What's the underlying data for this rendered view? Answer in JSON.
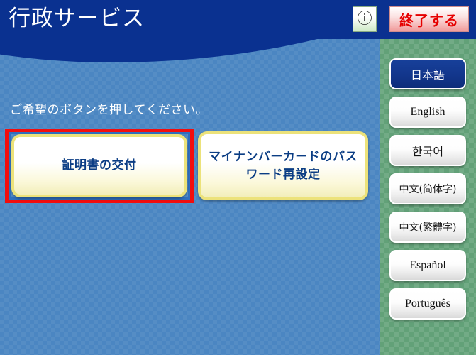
{
  "header": {
    "title": "行政サービス",
    "help_icon": "question-mark-circle-icon",
    "help_label": "?",
    "exit_label": "終了する"
  },
  "main": {
    "instruction": "ご希望のボタンを押してください。",
    "buttons": [
      {
        "label": "証明書の交付",
        "selected": true
      },
      {
        "label": "マイナンバーカードのパスワード再設定",
        "selected": false
      }
    ]
  },
  "sidebar": {
    "languages": [
      {
        "label": "日本語",
        "selected": true
      },
      {
        "label": "English",
        "selected": false
      },
      {
        "label": "한국어",
        "selected": false
      },
      {
        "label": "中文(简体字)",
        "selected": false
      },
      {
        "label": "中文(繁體字)",
        "selected": false
      },
      {
        "label": "Español",
        "selected": false
      },
      {
        "label": "Português",
        "selected": false
      }
    ]
  },
  "colors": {
    "header_blue": "#0a3190",
    "panel_blue": "#4b86c2",
    "sidebar_green": "#62a178",
    "selection_red": "#f20d0d",
    "button_yellow": "#ece27a",
    "button_text": "#0b3d84",
    "exit_text": "#e60000"
  }
}
